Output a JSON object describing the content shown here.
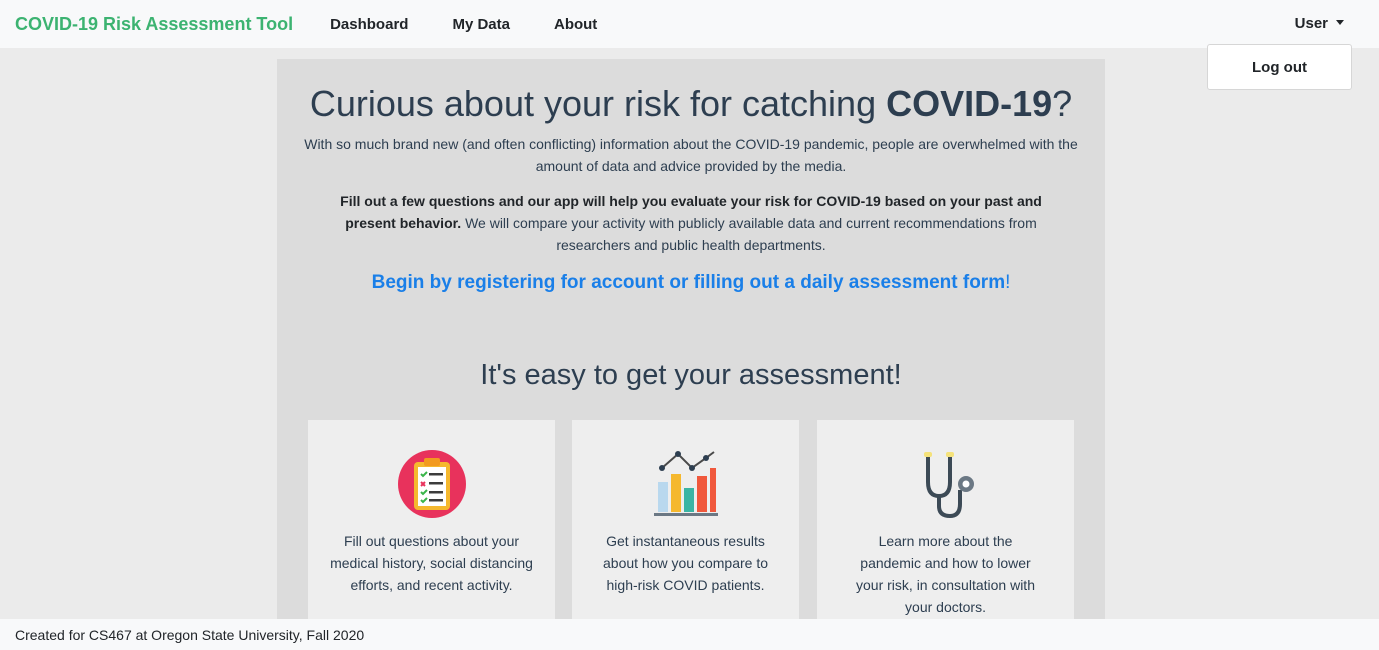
{
  "nav": {
    "brand": "COVID-19 Risk Assessment Tool",
    "links": [
      "Dashboard",
      "My Data",
      "About"
    ],
    "user": "User",
    "dropdown_item": "Log out"
  },
  "colors": {
    "brand": "#3cb371",
    "link": "#1a7fe8",
    "panel": "#dcdcdc",
    "heading": "#2d3e50"
  },
  "hero": {
    "title_prefix": "Curious about your risk for catching ",
    "title_bold": "COVID-19",
    "title_suffix": "?",
    "intro": "With so much brand new (and often conflicting) information about the COVID-19 pandemic, people are overwhelmed with the amount of data and advice provided by the media.",
    "intro2_bold": "Fill out a few questions and our app will help you evaluate your risk for COVID-19 based on your past and present behavior.",
    "intro2_rest": " We will compare your activity with publicly available data and current recommendations from researchers and public health departments.",
    "cta_link": "Begin by registering for account or filling out a daily assessment form",
    "cta_suffix": "!"
  },
  "steps": {
    "title": "It's easy to get your assessment!",
    "cards": [
      {
        "icon": "clipboard-checklist-icon",
        "text": "Fill out questions about your medical history, social distancing efforts, and recent activity."
      },
      {
        "icon": "bar-chart-icon",
        "text": "Get instantaneous results about how you compare to high-risk COVID patients."
      },
      {
        "icon": "stethoscope-icon",
        "text": "Learn more about the pandemic and how to lower your risk, in consultation with your doctors."
      }
    ]
  },
  "footer": {
    "text": "Created for CS467 at Oregon State University, Fall 2020"
  }
}
